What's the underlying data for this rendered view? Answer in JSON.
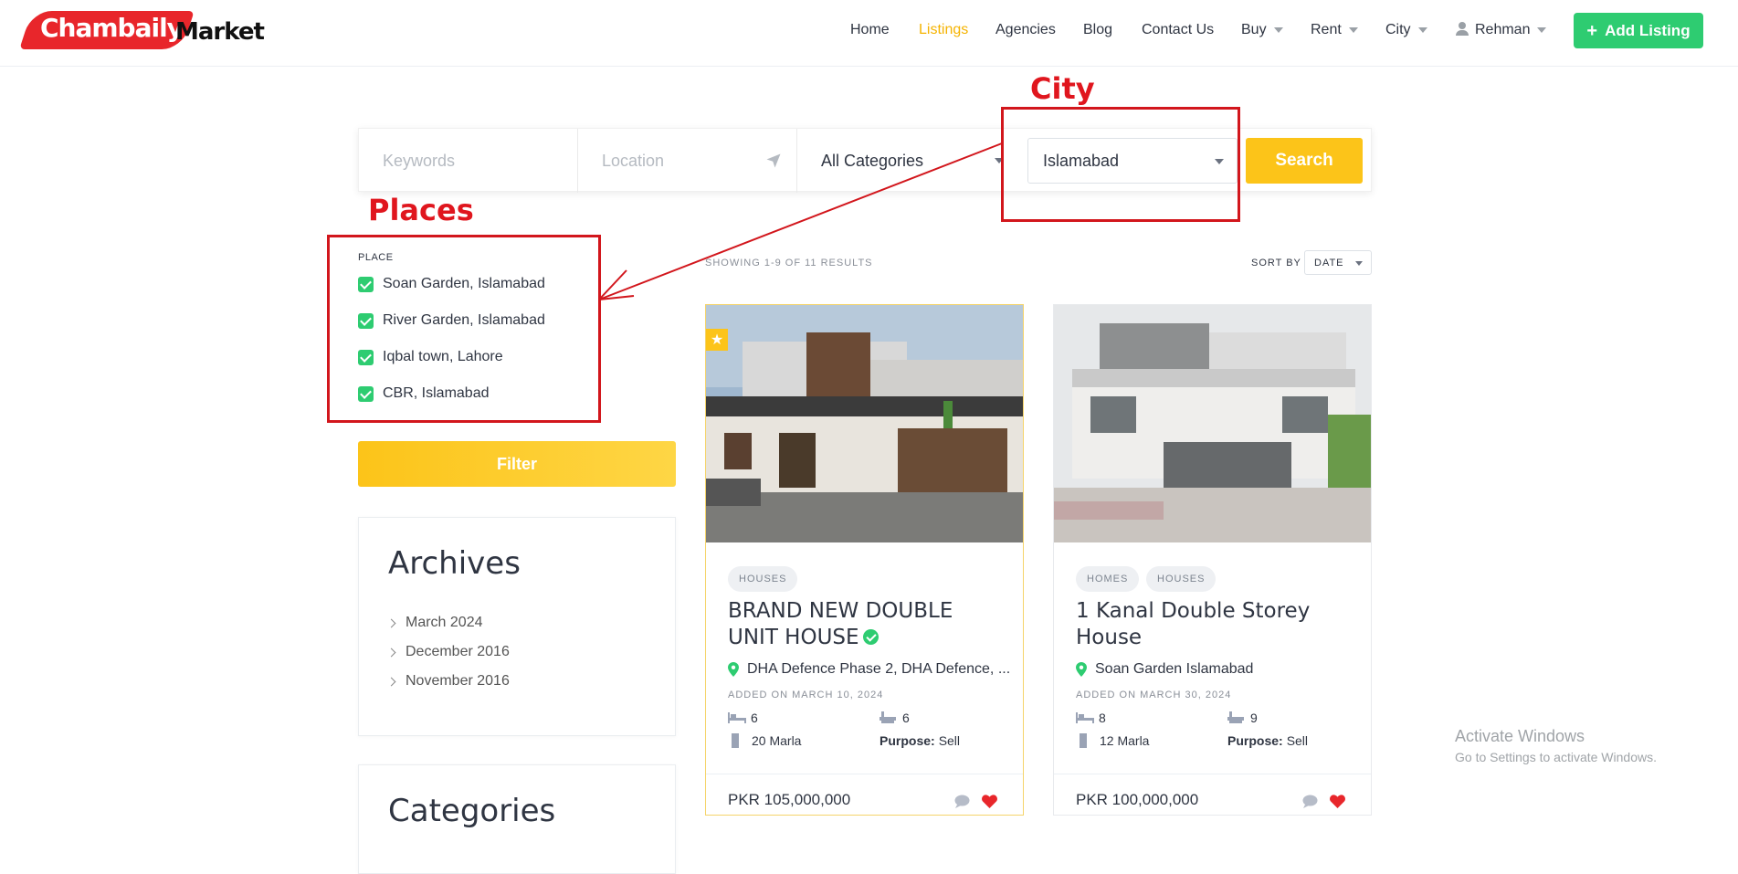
{
  "brand": {
    "name_part1": "Chambaily",
    "name_part2": "Market"
  },
  "nav": {
    "home": "Home",
    "listings": "Listings",
    "agencies": "Agencies",
    "blog": "Blog",
    "contact": "Contact Us",
    "buy": "Buy",
    "rent": "Rent",
    "city": "City",
    "user": "Rehman",
    "add_listing": "Add Listing"
  },
  "search": {
    "keywords_placeholder": "Keywords",
    "location_placeholder": "Location",
    "category": "All Categories",
    "city": "Islamabad",
    "button": "Search"
  },
  "annotations": {
    "city_label": "City",
    "places_label": "Places"
  },
  "filter": {
    "title": "PLACE",
    "places": [
      "Soan Garden, Islamabad",
      "River Garden, Islamabad",
      "Iqbal town, Lahore",
      "CBR, Islamabad"
    ],
    "button": "Filter"
  },
  "archives": {
    "title": "Archives",
    "items": [
      "March 2024",
      "December 2016",
      "November 2016"
    ]
  },
  "categories_widget": {
    "title": "Categories"
  },
  "results": {
    "count": "SHOWING 1-9 OF 11 RESULTS",
    "sort_label": "SORT BY",
    "sort_value": "DATE"
  },
  "listings": [
    {
      "tags": [
        "HOUSES"
      ],
      "title": "BRAND NEW DOUBLE UNIT HOUSE",
      "address": "DHA Defence Phase 2, DHA Defence, ...",
      "added": "ADDED ON MARCH 10, 2024",
      "beds": "6",
      "baths": "6",
      "area": "20 Marla",
      "purpose_label": "Purpose:",
      "purpose": "Sell",
      "price": "PKR 105,000,000"
    },
    {
      "tags": [
        "HOMES",
        "HOUSES"
      ],
      "title": "1 Kanal Double Storey House",
      "address": "Soan Garden Islamabad",
      "added": "ADDED ON MARCH 30, 2024",
      "beds": "8",
      "baths": "9",
      "area": "12 Marla",
      "purpose_label": "Purpose:",
      "purpose": "Sell",
      "price": "PKR 100,000,000"
    }
  ],
  "watermark": {
    "line1": "Activate Windows",
    "line2": "Go to Settings to activate Windows."
  },
  "colors": {
    "accent": "#fcc419",
    "green": "#2ecc71",
    "annotation_red": "#d2161c",
    "text": "#2f3542"
  }
}
